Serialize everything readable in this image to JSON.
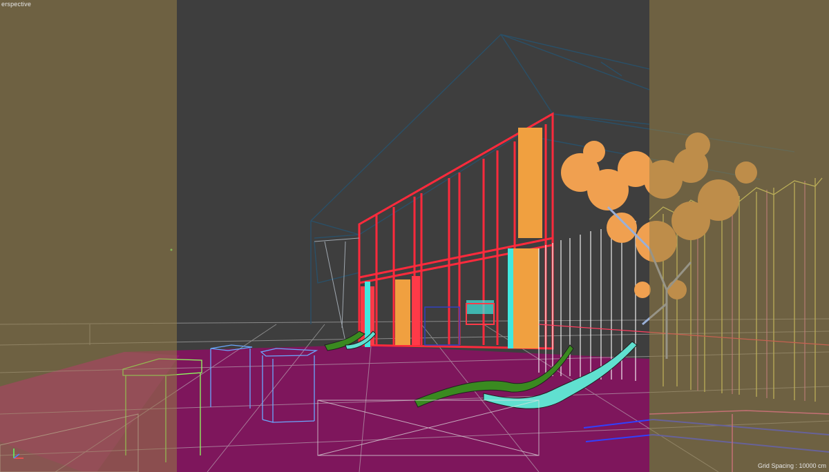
{
  "viewport": {
    "view_label": "erspective",
    "grid_readout": "Grid Spacing : 10000 cm"
  },
  "colors": {
    "background": "#3e3e3e",
    "safe_frame_overlay": "#967d46",
    "roof_wire": "#2a4a60",
    "facade_red": "#ff2a3c",
    "facade_orange": "#f0a040",
    "glass_cyan": "#40e8e0",
    "floor_magenta": "#b0107a",
    "tree_orange": "#f0a050",
    "tree_trunk": "#9ab0d8",
    "lounger_green": "#3a8a20",
    "lounger_cyan": "#60e0d0",
    "fence_yellow": "#e8e870",
    "grid_line": "#bbbbbb"
  }
}
